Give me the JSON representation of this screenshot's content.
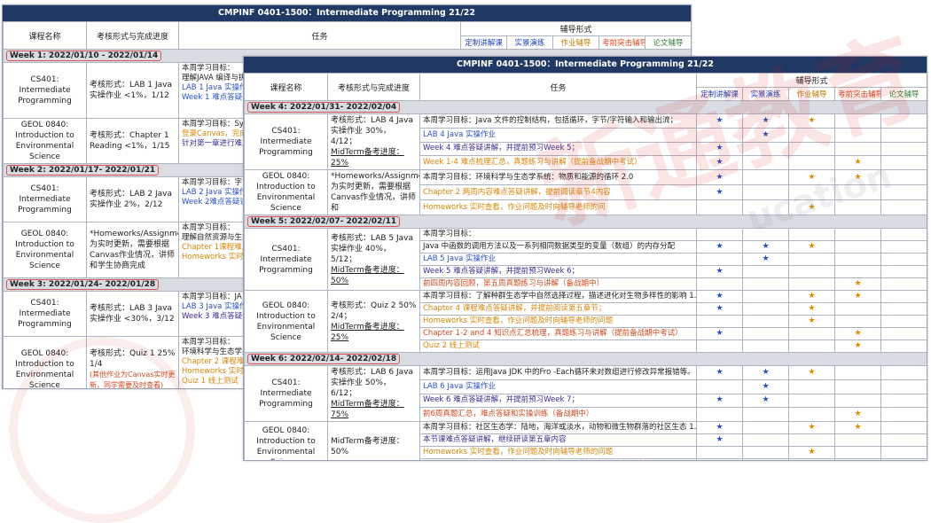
{
  "back_sheet": {
    "title": "CMPINF 0401-1500：Intermediate Programming 21/22",
    "headers": {
      "course": "课程名称",
      "assessment": "考核形式与完成进度",
      "task": "任务",
      "modes": "辅导形式"
    },
    "modes": [
      "定制讲解课",
      "实景演练",
      "作业辅导",
      "考前突击辅导",
      "论文辅导"
    ],
    "weeks": [
      {
        "label": "Week 1: 2022/01/10 - 2022/01/14",
        "courses": [
          {
            "course": "CS401: Intermediate Programming",
            "assessment": "考核形式：LAB 1 Java 实操作业 <1%，1/12",
            "tasks": [
              {
                "text": "本周学习目标：",
                "color": "black"
              },
              {
                "text": "理解JAVA 编译与执",
                "color": "black"
              },
              {
                "text": "LAB 1 Java 实操作",
                "color": "blue"
              },
              {
                "text": "Week 1 难点答疑",
                "color": "blue"
              }
            ]
          },
          {
            "course": "GEOL 0840: Introduction to Environmental Science",
            "assessment": "考核形式：Chapter 1 Reading <1%，1/15",
            "tasks": [
              {
                "text": "本周学习目标：Syl",
                "color": "black"
              },
              {
                "text": "登录Canvas，完成",
                "color": "orange"
              },
              {
                "text": "针对第一章进行难点",
                "color": "purple"
              }
            ]
          }
        ]
      },
      {
        "label": "Week 2: 2022/01/17- 2022/01/21",
        "courses": [
          {
            "course": "CS401: Intermediate Programming",
            "assessment": "考核形式：LAB 2 Java 实操作业 2%，2/12",
            "tasks": [
              {
                "text": "本周学习目标：字",
                "color": "black"
              },
              {
                "text": "LAB 2 Java 实操作",
                "color": "blue"
              },
              {
                "text": "Week 2难点答疑讲",
                "color": "blue"
              }
            ]
          },
          {
            "course": "GEOL 0840: Introduction to Environmental Science",
            "assessment": "*Homeworks/Assignments 为实时更新，需要根据Canvas作业情况，讲师和学生协商完成",
            "tasks": [
              {
                "text": "本周学习目标：",
                "color": "black"
              },
              {
                "text": "理解自然资源与生态",
                "color": "black"
              },
              {
                "text": "Chapter 1课程难点",
                "color": "orange"
              },
              {
                "text": "Homeworks 实时查",
                "color": "orange"
              }
            ]
          }
        ]
      },
      {
        "label": "Week 3: 2022/01/24- 2022/01/28",
        "courses": [
          {
            "course": "CS401: Intermediate Programming",
            "assessment": "考核形式：LAB 3 Java 实操作业 <30%，3/12",
            "tasks": [
              {
                "text": "本周学习目标：JA",
                "color": "black"
              },
              {
                "text": "LAB 3 Java 实操作",
                "color": "blue"
              },
              {
                "text": "Week 3 难点答疑讲",
                "color": "purple"
              }
            ]
          },
          {
            "course": "GEOL 0840: Introduction to Environmental Science",
            "assessment": "考核形式：Quiz 1 25% 1/4",
            "assessment_note": "(其他作业为Canvas实时更新，同学需要及时查看)",
            "tasks": [
              {
                "text": "本周学习目标：",
                "color": "black"
              },
              {
                "text": "环境科学与生态学关",
                "color": "black"
              },
              {
                "text": "Chapter 2 课程难点",
                "color": "orange"
              },
              {
                "text": "Homeworks 实时查",
                "color": "orange"
              },
              {
                "text": "Quiz 1 线上测试",
                "color": "orange"
              }
            ]
          }
        ]
      }
    ]
  },
  "front_sheet": {
    "title": "CMPINF 0401-1500：Intermediate Programming 21/22",
    "headers": {
      "course": "课程名称",
      "assessment": "考核形式与完成进度",
      "task": "任务",
      "modes": "辅导形式"
    },
    "modes": [
      "定制讲解课",
      "实景演练",
      "作业辅导",
      "考前突击辅导",
      "论文辅导"
    ],
    "weeks": [
      {
        "label": "Week 4: 2022/01/31- 2022/02/04",
        "courses": [
          {
            "course": "CS401: Intermediate Programming",
            "assessment": "考核形式：LAB 4 Java 实操作业 30%，4/12；",
            "assessment2": "MidTerm备考进度：25%",
            "rows": [
              {
                "text": "本周学习目标：Java 文件的控制结构，包括循环，字节/字符输入和输出流；",
                "color": "black",
                "m": [
                  "★",
                  "★",
                  "★",
                  "",
                  ""
                ]
              },
              {
                "text": "LAB 4 Java 实操作业",
                "color": "blue",
                "m": [
                  "",
                  "★",
                  "",
                  "",
                  ""
                ]
              },
              {
                "text": "Week 4 难点答疑讲解，并提前预习Week 5；",
                "color": "purple",
                "m": [
                  "★",
                  "",
                  "",
                  "",
                  ""
                ]
              },
              {
                "text": "Week 1-4 难点梳理汇总，真题练习与讲解（提前备战期中考试）",
                "color": "orange",
                "m": [
                  "★",
                  "",
                  "",
                  "★",
                  ""
                ]
              }
            ]
          },
          {
            "course": "GEOL 0840: Introduction to Environmental Science",
            "assessment": "*Homeworks/Assignments 为实时更新，需要根据Canvas作业情况，讲师和",
            "rows": [
              {
                "text": "本周学习目标：环境科学与生态学系统：物质和能源的循环 2.0",
                "color": "black",
                "m": [
                  "★",
                  "",
                  "★",
                  "★",
                  ""
                ]
              },
              {
                "text": "Chapter 2 两周内容难点答疑讲解，提前阅读章节4内容",
                "color": "orange",
                "m": [
                  "★",
                  "",
                  "",
                  "",
                  ""
                ]
              },
              {
                "text": "Homeworks 实时查看，作业问题及时向辅导老师的问",
                "color": "orange",
                "m": [
                  "",
                  "",
                  "★",
                  "",
                  ""
                ]
              }
            ]
          }
        ]
      },
      {
        "label": "Week 5: 2022/02/07- 2022/02/11",
        "courses": [
          {
            "course": "CS401: Intermediate Programming",
            "assessment": "考核形式：LAB 5 Java 实操作业 40%，5/12；",
            "assessment2": "MidTerm备考进度：50%",
            "rows": [
              {
                "text": "本周学习目标：",
                "color": "black",
                "m": [
                  "",
                  "",
                  "",
                  "",
                  ""
                ]
              },
              {
                "text": "Java 中函数的调用方法以及一系列相同数据类型的变量（数组）的内存分配",
                "color": "black",
                "m": [
                  "★",
                  "★",
                  "★",
                  "",
                  ""
                ]
              },
              {
                "text": "LAB 5 Java 实操作业",
                "color": "blue",
                "m": [
                  "",
                  "★",
                  "",
                  "",
                  ""
                ]
              },
              {
                "text": "Week 5 难点答疑讲解，并提前预习Week 6；",
                "color": "purple",
                "m": [
                  "★",
                  "",
                  "",
                  "",
                  ""
                ]
              },
              {
                "text": "前四周内容回顾，第五周真题练习与讲解（备战期中）",
                "color": "red",
                "m": [
                  "",
                  "",
                  "",
                  "★",
                  ""
                ]
              }
            ]
          },
          {
            "course": "GEOL 0840: Introduction to Environmental Science",
            "assessment": "考核形式：Quiz 2 50% 2/4；",
            "assessment2": "MidTerm备考进度：25%",
            "rows": [
              {
                "text": "本周学习目标：了解种群生态学中自然选择过程，描述进化对生物多样性的影响 1.0",
                "color": "black",
                "m": [
                  "★",
                  "",
                  "★",
                  "★",
                  ""
                ]
              },
              {
                "text": "Chapter 4 课程难点答疑讲解，并提前阅读第五章节；",
                "color": "orange",
                "m": [
                  "★",
                  "",
                  "★",
                  "",
                  ""
                ]
              },
              {
                "text": "Homeworks 实时查看，作业问题及时向辅导老师的问题",
                "color": "orange",
                "m": [
                  "",
                  "",
                  "★",
                  "",
                  ""
                ]
              },
              {
                "text": "Chapter 1-2 and 4 知识点汇总梳理，真题练习与讲解（提前备战期中考试）",
                "color": "red",
                "m": [
                  "★",
                  "",
                  "",
                  "★",
                  ""
                ]
              },
              {
                "text": "Quiz 2 线上测试",
                "color": "orange",
                "m": [
                  "",
                  "",
                  "",
                  "★",
                  ""
                ]
              }
            ]
          }
        ]
      },
      {
        "label": "Week 6: 2022/02/14- 2022/02/18",
        "courses": [
          {
            "course": "CS401: Intermediate Programming",
            "assessment": "考核形式：LAB 6 Java 实操作业 50%，6/12；",
            "assessment2": "MidTerm备考进度：75%",
            "rows": [
              {
                "text": "本周学习目标：运用Java JDK 中的Fro -Each循环来对数组进行修改异常报错等。",
                "color": "black",
                "m": [
                  "★",
                  "★",
                  "★",
                  "",
                  ""
                ]
              },
              {
                "text": "LAB 6 Java 实操作业",
                "color": "blue",
                "m": [
                  "",
                  "★",
                  "",
                  "",
                  ""
                ]
              },
              {
                "text": "Week 6 难点答疑讲解，并提前预习Week 7；",
                "color": "purple",
                "m": [
                  "★",
                  "★",
                  "",
                  "",
                  ""
                ]
              },
              {
                "text": "前6周真题汇总，难点答疑和实操训练（备战期中）",
                "color": "red",
                "m": [
                  "",
                  "",
                  "",
                  "★",
                  ""
                ]
              }
            ]
          },
          {
            "course": "GEOL 0840: Introduction to Environmental Science",
            "assessment": "MidTerm备考进度：50%",
            "rows": [
              {
                "text": "本周学习目标：社区生态学：陆地，海洋或淡水，动物和微生物群落的社区生态 1.0",
                "color": "black",
                "m": [
                  "★",
                  "",
                  "★",
                  "★",
                  ""
                ]
              },
              {
                "text": "本节课难点答疑讲解，继续研读第五章内容",
                "color": "purple",
                "m": [
                  "★",
                  "",
                  "",
                  "",
                  ""
                ]
              },
              {
                "text": "Homeworks 实时查看，作业问题及时向辅导老师的问题",
                "color": "orange",
                "m": [
                  "",
                  "",
                  "★",
                  "",
                  ""
                ]
              },
              {
                "text": "Chapter 1-2 and 4 知识点回顾，真题练习与讲解（提前备战期中）",
                "color": "red",
                "m": [
                  "",
                  "",
                  "",
                  "★",
                  ""
                ]
              }
            ]
          }
        ]
      }
    ]
  },
  "watermark": {
    "text": "新通教育",
    "sub": "ucation"
  }
}
